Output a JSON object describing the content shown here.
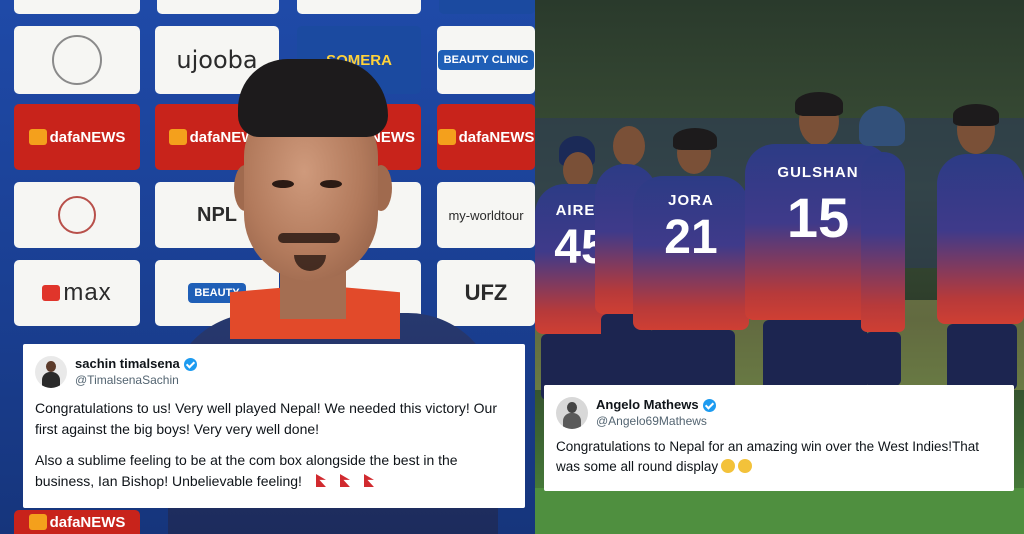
{
  "left_photo": {
    "sponsor_boards": [
      "ujooba",
      "SOMERA",
      "BEAUTY CLINIC",
      "dafaNEWS",
      "dafaNEWS",
      "NEWS",
      "dafaNEWS",
      "NPL",
      "my-worldtour",
      "max",
      "BEAUTY",
      "UFZ",
      "dafaNEWS"
    ]
  },
  "right_photo": {
    "players": [
      {
        "name": "AIREE",
        "number": "45"
      },
      {
        "name": "JORA",
        "number": "21"
      },
      {
        "name": "GULSHAN",
        "number": "15"
      }
    ]
  },
  "tweets": [
    {
      "display_name": "sachin timalsena",
      "handle": "@TimalsenaSachin",
      "verified": true,
      "paragraphs": [
        "Congratulations to us! Very well played Nepal! We needed this victory! Our first against the big boys! Very very well done!",
        "Also a sublime feeling to be at the com box alongside the best in the business, Ian Bishop! Unbelievable feeling!"
      ],
      "emoji": [
        "flag-nepal",
        "flag-nepal",
        "flag-nepal"
      ]
    },
    {
      "display_name": "Angelo Mathews",
      "handle": "@Angelo69Mathews",
      "verified": true,
      "paragraphs": [
        "Congratulations to Nepal for an amazing win over the West Indies!That was some all round display"
      ],
      "emoji": [
        "clapping-hands",
        "clapping-hands"
      ]
    }
  ],
  "colors": {
    "verified": "#1d9bf0",
    "handle": "#536471",
    "jersey_red": "#cf3f33",
    "jersey_navy": "#2c3b85"
  }
}
